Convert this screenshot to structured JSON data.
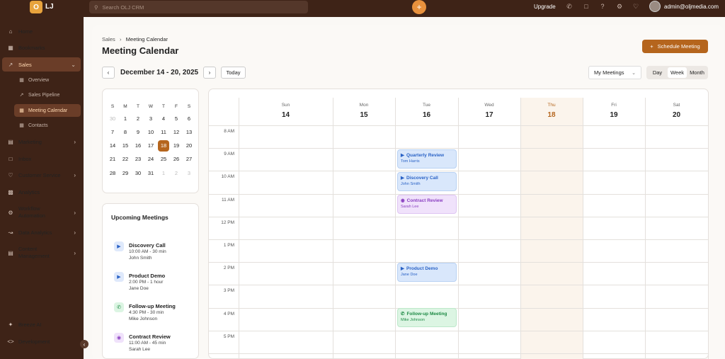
{
  "app": {
    "logo_letter": "O",
    "brand": "LJ"
  },
  "topbar": {
    "search_placeholder": "Search OLJ CRM",
    "upgrade": "Upgrade",
    "user": "admin@oljmedia.com",
    "icons": [
      "phone-icon",
      "chat-icon",
      "help-icon",
      "settings-icon",
      "bell-icon"
    ]
  },
  "sidebar": {
    "items": [
      {
        "label": "Home"
      },
      {
        "label": "Bookmarks"
      },
      {
        "label": "Sales"
      },
      {
        "label": "Marketing"
      },
      {
        "label": "Inbox"
      },
      {
        "label": "Customer Service"
      },
      {
        "label": "Analytics"
      },
      {
        "label": "Workflow Automation"
      },
      {
        "label": "Data Analytics"
      },
      {
        "label": "Content Management"
      }
    ],
    "sales_sub": [
      {
        "label": "Overview"
      },
      {
        "label": "Sales Pipeline"
      },
      {
        "label": "Meeting Calendar"
      },
      {
        "label": "Contacts"
      }
    ],
    "bottom": [
      {
        "label": "Breeze AI"
      },
      {
        "label": "Development"
      }
    ]
  },
  "page": {
    "breadcrumb_root": "Sales",
    "breadcrumb_current": "Meeting Calendar",
    "title": "Meeting Calendar",
    "schedule_button": "Schedule Meeting",
    "range": "December 14 - 20, 2025",
    "today": "Today",
    "filter": "My Meetings",
    "views": [
      "Day",
      "Week",
      "Month"
    ],
    "active_view": "Week"
  },
  "mini_calendar": {
    "weekdays": [
      "S",
      "M",
      "T",
      "W",
      "T",
      "F",
      "S"
    ],
    "weeks": [
      [
        "30",
        "1",
        "2",
        "3",
        "4",
        "5",
        "6"
      ],
      [
        "7",
        "8",
        "9",
        "10",
        "11",
        "12",
        "13"
      ],
      [
        "14",
        "15",
        "16",
        "17",
        "18",
        "19",
        "20"
      ],
      [
        "21",
        "22",
        "23",
        "24",
        "25",
        "26",
        "27"
      ],
      [
        "28",
        "29",
        "30",
        "31",
        "1",
        "2",
        "3"
      ]
    ],
    "selected": "18"
  },
  "upcoming": {
    "title": "Upcoming Meetings",
    "items": [
      {
        "name": "Discovery Call",
        "time": "10:00 AM - 30 min",
        "person": "John Smith",
        "kind": "video"
      },
      {
        "name": "Product Demo",
        "time": "2:00 PM - 1 hour",
        "person": "Jane Doe",
        "kind": "video"
      },
      {
        "name": "Follow-up Meeting",
        "time": "4:30 PM - 30 min",
        "person": "Mike Johnson",
        "kind": "phone"
      },
      {
        "name": "Contract Review",
        "time": "11:00 AM - 45 min",
        "person": "Sarah Lee",
        "kind": "location"
      }
    ]
  },
  "week": {
    "days": [
      {
        "dow": "Sun",
        "num": "14"
      },
      {
        "dow": "Mon",
        "num": "15"
      },
      {
        "dow": "Tue",
        "num": "16"
      },
      {
        "dow": "Wed",
        "num": "17"
      },
      {
        "dow": "Thu",
        "num": "18"
      },
      {
        "dow": "Fri",
        "num": "19"
      },
      {
        "dow": "Sat",
        "num": "20"
      }
    ],
    "today_index": 4,
    "hours": [
      "8 AM",
      "9 AM",
      "10 AM",
      "11 AM",
      "12 PM",
      "1 PM",
      "2 PM",
      "3 PM",
      "4 PM",
      "5 PM"
    ],
    "events": [
      {
        "title": "Quarterly Review",
        "person": "Tom Harris",
        "color": "blue",
        "icon": "video"
      },
      {
        "title": "Discovery Call",
        "person": "John Smith",
        "color": "blue",
        "icon": "video"
      },
      {
        "title": "Contract Review",
        "person": "Sarah Lee",
        "color": "purple",
        "icon": "location"
      },
      {
        "title": "Product Demo",
        "person": "Jane Doe",
        "color": "blue",
        "icon": "video"
      },
      {
        "title": "Follow-up Meeting",
        "person": "Mike Johnson",
        "color": "green",
        "icon": "phone"
      }
    ]
  },
  "colors": {
    "brand_dark": "#3e2317",
    "accent": "#b5651d",
    "plus": "#e8913d"
  }
}
